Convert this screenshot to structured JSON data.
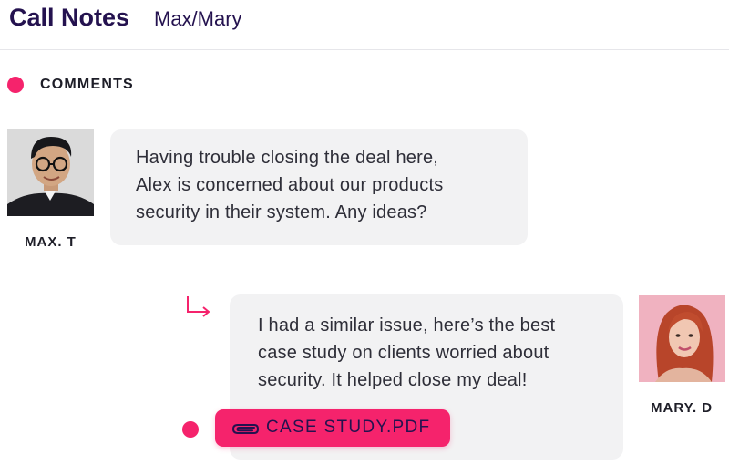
{
  "header": {
    "title": "Call Notes",
    "subtitle": "Max/Mary"
  },
  "section": {
    "label": "COMMENTS"
  },
  "colors": {
    "accent": "#f5236c",
    "heading": "#24124f",
    "bubble": "#f2f2f3"
  },
  "comments": [
    {
      "author": "MAX. T",
      "avatar_icon": "user-photo-max",
      "lines": [
        "Having trouble closing the deal here,",
        "Alex is concerned about our products",
        "security in their system. Any ideas?"
      ]
    },
    {
      "author": "MARY. D",
      "avatar_icon": "user-photo-mary",
      "is_reply": true,
      "reply_icon": "reply-arrow-icon",
      "lines": [
        "I had a similar issue, here’s the best",
        "case study on clients worried about",
        "security. It helped close my deal!"
      ],
      "attachment": {
        "icon": "paperclip-icon",
        "label": "CASE STUDY.PDF"
      }
    }
  ]
}
